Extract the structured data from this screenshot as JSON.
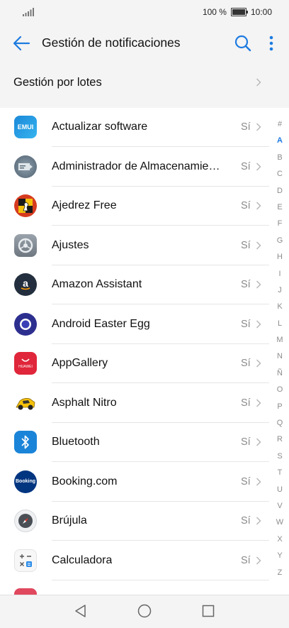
{
  "status_bar": {
    "battery": "100 %",
    "time": "10:00"
  },
  "header": {
    "title": "Gestión de notificaciones"
  },
  "batch": {
    "label": "Gestión por lotes"
  },
  "apps": [
    {
      "name": "Actualizar software",
      "status": "Sí",
      "icon": "emui-update-icon"
    },
    {
      "name": "Administrador de Almacenamie…",
      "status": "Sí",
      "icon": "storage-manager-icon"
    },
    {
      "name": "Ajedrez Free",
      "status": "Sí",
      "icon": "chess-icon"
    },
    {
      "name": "Ajustes",
      "status": "Sí",
      "icon": "settings-gear-icon"
    },
    {
      "name": "Amazon Assistant",
      "status": "Sí",
      "icon": "amazon-icon"
    },
    {
      "name": "Android Easter Egg",
      "status": "Sí",
      "icon": "android-easter-egg-icon"
    },
    {
      "name": "AppGallery",
      "status": "Sí",
      "icon": "appgallery-icon"
    },
    {
      "name": "Asphalt Nitro",
      "status": "Sí",
      "icon": "asphalt-car-icon"
    },
    {
      "name": "Bluetooth",
      "status": "Sí",
      "icon": "bluetooth-icon"
    },
    {
      "name": "Booking.com",
      "status": "Sí",
      "icon": "booking-icon"
    },
    {
      "name": "Brújula",
      "status": "Sí",
      "icon": "compass-icon"
    },
    {
      "name": "Calculadora",
      "status": "Sí",
      "icon": "calculator-icon"
    }
  ],
  "icon_text": {
    "emui": "EMUI",
    "huawei": "HUAWEI",
    "booking": "Booking"
  },
  "index_letters": [
    "#",
    "A",
    "B",
    "C",
    "D",
    "E",
    "F",
    "G",
    "H",
    "I",
    "J",
    "K",
    "L",
    "M",
    "N",
    "Ñ",
    "O",
    "P",
    "Q",
    "R",
    "S",
    "T",
    "U",
    "V",
    "W",
    "X",
    "Y",
    "Z"
  ],
  "index_active": "A",
  "colors": {
    "accent": "#1e7be0",
    "status_text": "#8a8a8a"
  }
}
